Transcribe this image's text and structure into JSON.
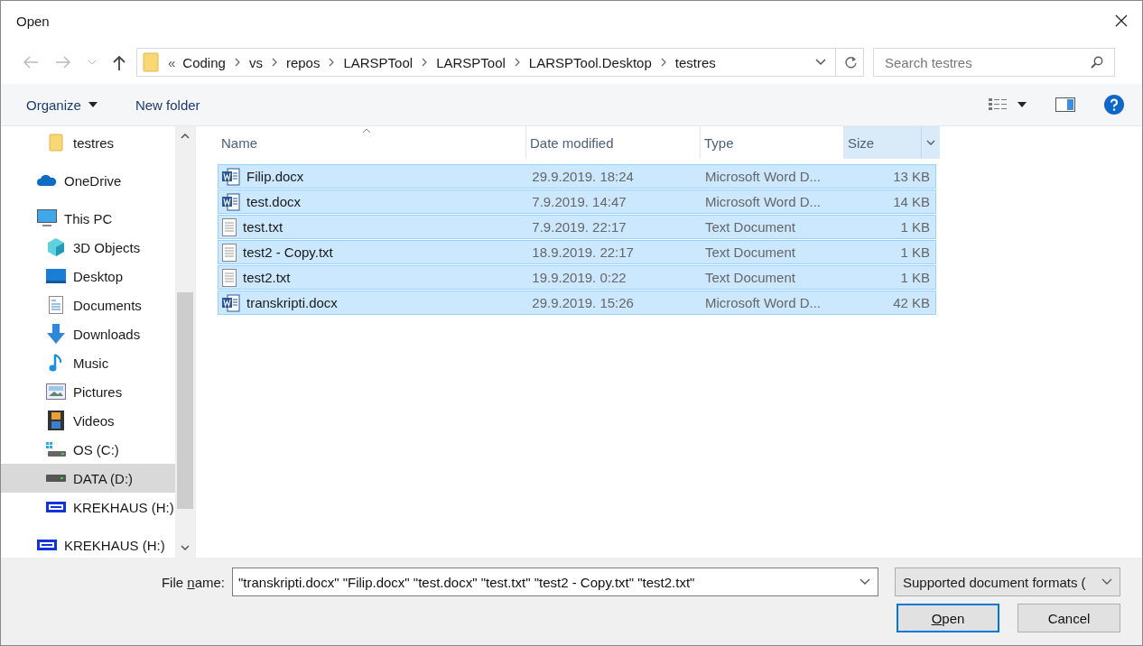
{
  "window": {
    "title": "Open"
  },
  "address": {
    "overflow": "«",
    "crumbs": [
      "Coding",
      "vs",
      "repos",
      "LARSPTool",
      "LARSPTool",
      "LARSPTool.Desktop",
      "testres"
    ]
  },
  "search": {
    "placeholder": "Search testres"
  },
  "toolbar": {
    "organize": "Organize",
    "new_folder": "New folder"
  },
  "sidebar": {
    "items": [
      {
        "children": [
          {
            "label": "testres",
            "kind": "folder",
            "selected": false
          }
        ]
      },
      {
        "label": "OneDrive",
        "kind": "cloud",
        "selected": false
      },
      {
        "label": "This PC",
        "kind": "pc",
        "selected": false,
        "children": [
          {
            "label": "3D Objects",
            "kind": "cube",
            "selected": false
          },
          {
            "label": "Desktop",
            "kind": "desktop",
            "selected": false
          },
          {
            "label": "Documents",
            "kind": "documents",
            "selected": false
          },
          {
            "label": "Downloads",
            "kind": "downloads",
            "selected": false
          },
          {
            "label": "Music",
            "kind": "music",
            "selected": false
          },
          {
            "label": "Pictures",
            "kind": "pictures",
            "selected": false
          },
          {
            "label": "Videos",
            "kind": "videos",
            "selected": false
          },
          {
            "label": "OS (C:)",
            "kind": "osdrive",
            "selected": false
          },
          {
            "label": "DATA (D:)",
            "kind": "drive",
            "selected": true
          },
          {
            "label": "KREKHAUS (H:)",
            "kind": "extdrive",
            "selected": false
          }
        ]
      },
      {
        "label": "KREKHAUS (H:)",
        "kind": "extdrive",
        "selected": false
      }
    ]
  },
  "table": {
    "columns": [
      {
        "label": "Name",
        "sorted": true,
        "hovered": false
      },
      {
        "label": "Date modified",
        "sorted": false,
        "hovered": false
      },
      {
        "label": "Type",
        "sorted": false,
        "hovered": false
      },
      {
        "label": "Size",
        "sorted": false,
        "hovered": true
      }
    ],
    "rows": [
      {
        "name": "Filip.docx",
        "kind": "word",
        "date": "29.9.2019. 18:24",
        "type": "Microsoft Word D...",
        "size": "13 KB",
        "selected": true
      },
      {
        "name": "test.docx",
        "kind": "word",
        "date": "7.9.2019. 14:47",
        "type": "Microsoft Word D...",
        "size": "14 KB",
        "selected": true
      },
      {
        "name": "test.txt",
        "kind": "text",
        "date": "7.9.2019. 22:17",
        "type": "Text Document",
        "size": "1 KB",
        "selected": true
      },
      {
        "name": "test2 - Copy.txt",
        "kind": "text",
        "date": "18.9.2019. 22:17",
        "type": "Text Document",
        "size": "1 KB",
        "selected": true
      },
      {
        "name": "test2.txt",
        "kind": "text",
        "date": "19.9.2019. 0:22",
        "type": "Text Document",
        "size": "1 KB",
        "selected": true
      },
      {
        "name": "transkripti.docx",
        "kind": "word",
        "date": "29.9.2019. 15:26",
        "type": "Microsoft Word D...",
        "size": "42 KB",
        "selected": true
      }
    ]
  },
  "footer": {
    "file_name_label": {
      "before": "File ",
      "accel": "n",
      "after": "ame:"
    },
    "file_name": "\"transkripti.docx\" \"Filip.docx\" \"test.docx\" \"test.txt\" \"test2 - Copy.txt\" \"test2.txt\"",
    "filter": "Supported document formats (",
    "open": {
      "accel": "O",
      "after": "pen"
    },
    "cancel": "Cancel"
  }
}
